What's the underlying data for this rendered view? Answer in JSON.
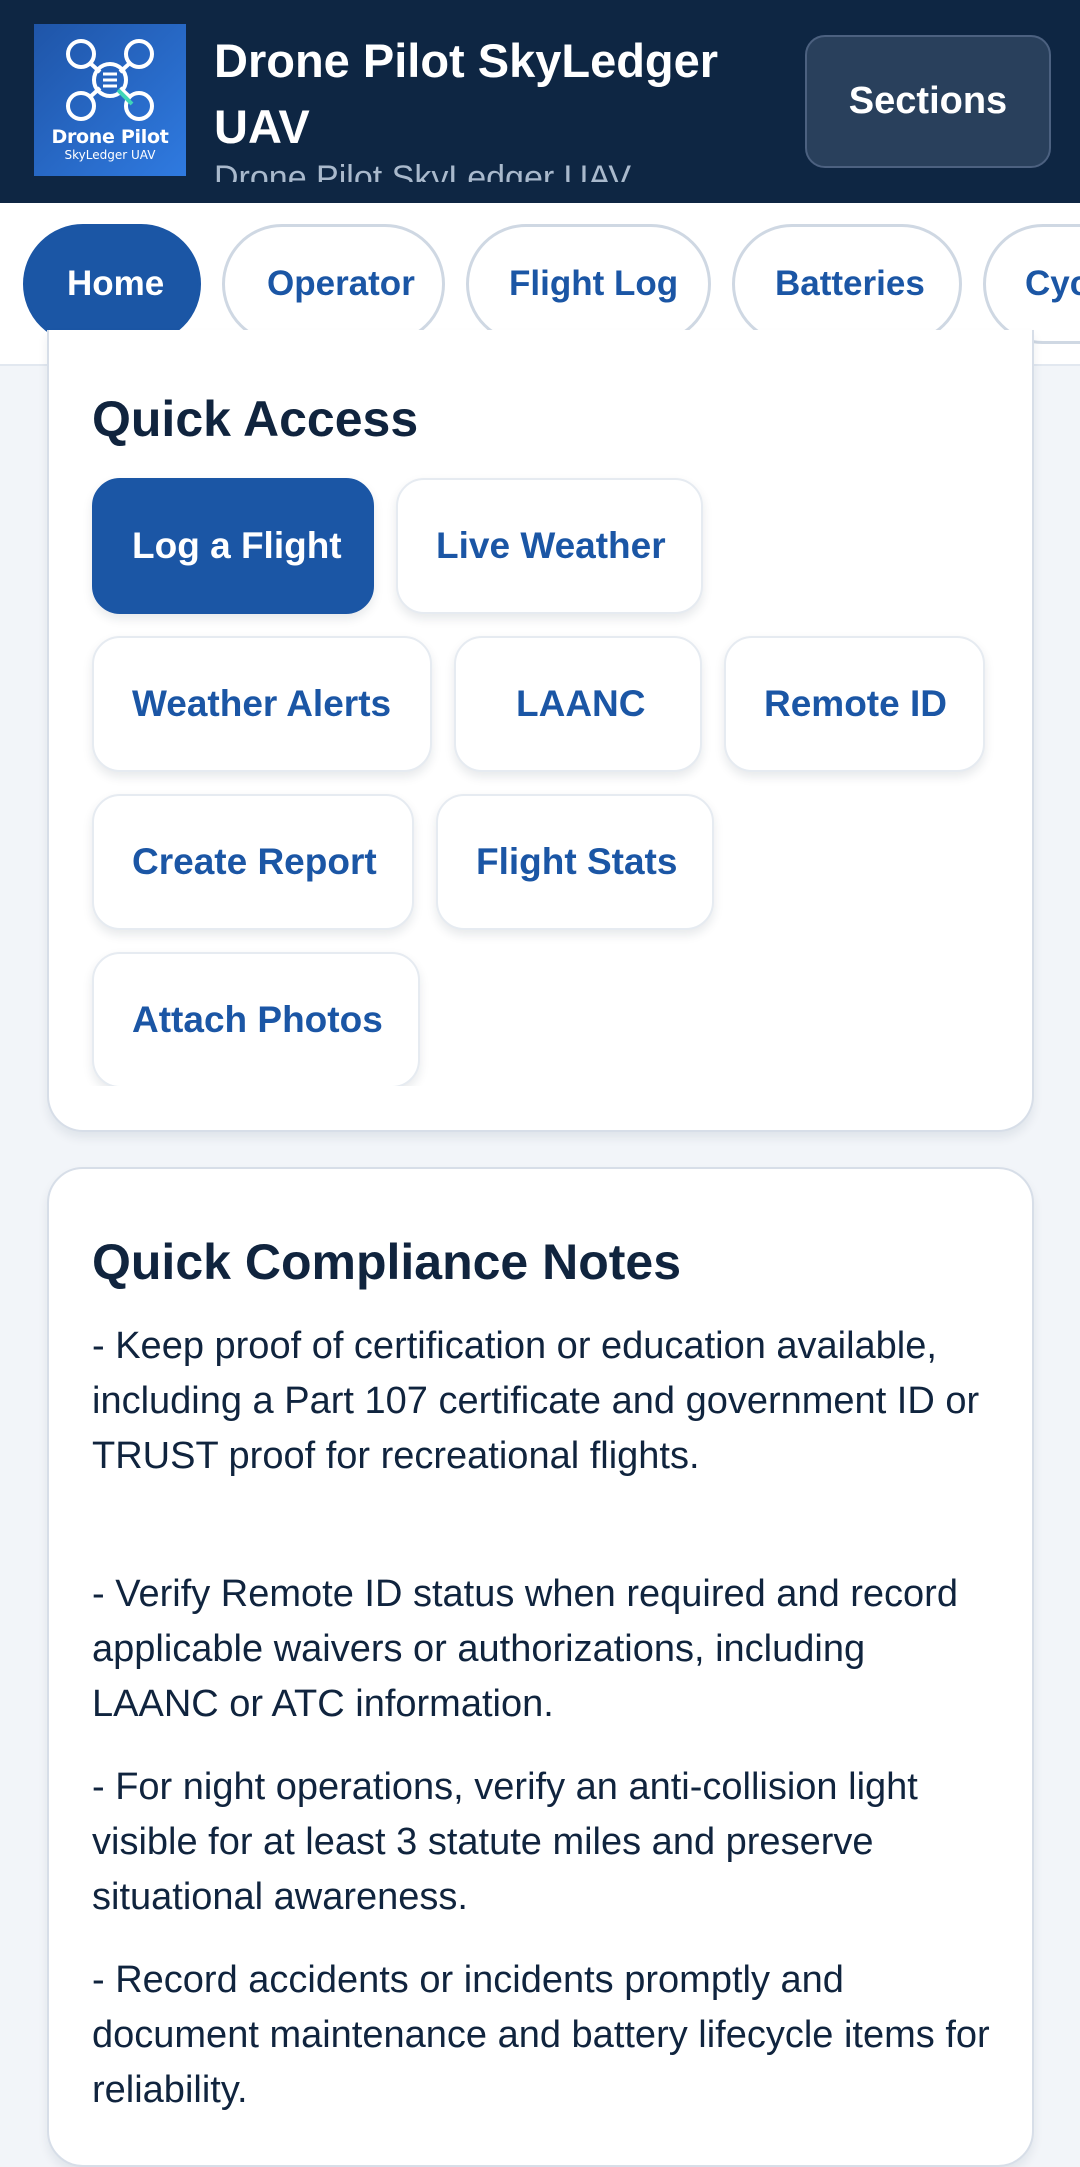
{
  "header": {
    "logo_line1": "Drone Pilot",
    "logo_line2": "SkyLedger UAV",
    "title": "Drone Pilot SkyLedger UAV",
    "subtitle": "Drone Pilot SkyLedger UAV",
    "sections_label": "Sections",
    "background_color": "#0e2643"
  },
  "nav": {
    "tabs": [
      {
        "label": "Home",
        "active": true
      },
      {
        "label": "Operator",
        "active": false
      },
      {
        "label": "Flight Log",
        "active": false
      },
      {
        "label": "Batteries",
        "active": false
      },
      {
        "label": "Cycles",
        "active": false
      }
    ]
  },
  "quick_access": {
    "title": "Quick Access",
    "buttons": [
      {
        "label": "Log a Flight",
        "primary": true
      },
      {
        "label": "Live Weather",
        "primary": false
      },
      {
        "label": "Weather Alerts",
        "primary": false
      },
      {
        "label": "LAANC",
        "primary": false
      },
      {
        "label": "Remote ID",
        "primary": false
      },
      {
        "label": "Create Report",
        "primary": false
      },
      {
        "label": "Flight Stats",
        "primary": false
      },
      {
        "label": "Attach Photos",
        "primary": false
      }
    ]
  },
  "compliance": {
    "title": "Quick Compliance Notes",
    "notes": [
      "- Keep proof of certification or education available, including a Part 107 certificate and government ID or TRUST proof for recreational flights.",
      "- Verify Remote ID status when required and record applicable waivers or authorizations, including LAANC or ATC information.",
      "- For night operations, verify an anti-collision light visible for at least 3 statute miles and preserve situational awareness.",
      "- Record accidents or incidents promptly and document maintenance and battery lifecycle items for reliability."
    ]
  },
  "colors": {
    "accent": "#1b56a5",
    "header_bg": "#0e2643",
    "page_bg": "#f2f5f9",
    "text": "#10243e"
  }
}
